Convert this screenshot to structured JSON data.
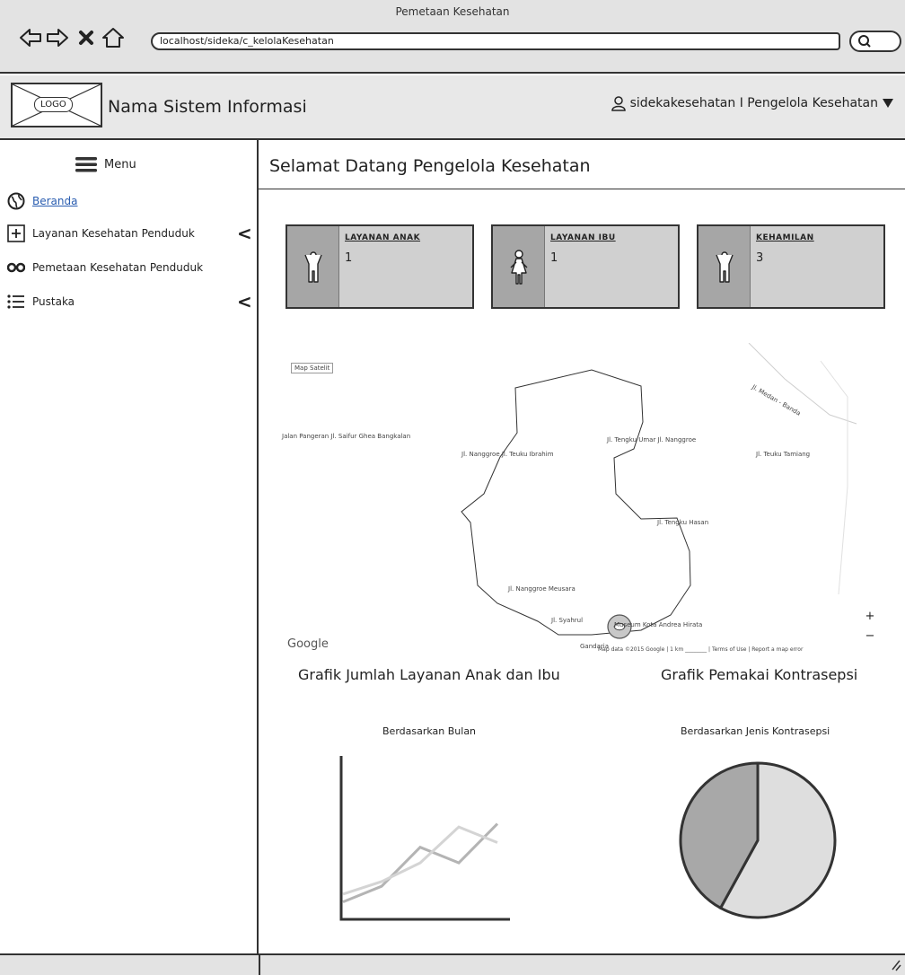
{
  "window": {
    "title": "Pemetaan Kesehatan",
    "url": "localhost/sideka/c_kelolaKesehatan"
  },
  "header": {
    "logo_text": "LOGO",
    "app_name": "Nama Sistem Informasi",
    "user_label": "sidekakesehatan I Pengelola Kesehatan"
  },
  "sidebar": {
    "menu_label": "Menu",
    "items": [
      {
        "label": "Beranda",
        "icon": "globe-icon",
        "active": true
      },
      {
        "label": "Layanan Kesehatan Penduduk",
        "icon": "plus-box-icon",
        "has_submenu": true
      },
      {
        "label": "Pemetaan Kesehatan Penduduk",
        "icon": "glasses-icon",
        "has_submenu": false
      },
      {
        "label": "Pustaka",
        "icon": "list-icon",
        "has_submenu": true
      }
    ]
  },
  "main": {
    "welcome": "Selamat Datang Pengelola Kesehatan",
    "cards": [
      {
        "title": "LAYANAN ANAK",
        "value": "1",
        "icon": "child-icon"
      },
      {
        "title": "LAYANAN IBU",
        "value": "1",
        "icon": "woman-icon"
      },
      {
        "title": "KEHAMILAN",
        "value": "3",
        "icon": "child-icon"
      }
    ],
    "map": {
      "type_label": "Map   Satelit",
      "google": "Google",
      "footer": "Map data ©2015 Google  |  1 km ________  |  Terms of Use  |  Report a map error",
      "place_labels": [
        "Jalan Pangeran Jl. Saifur Ghea Bangkalan",
        "Jl. Nanggroe Jl. Teuku Ibrahim",
        "Jl. Tengku Umar Jl. Nanggroe",
        "Jl. Medan - Banda",
        "Jl. Teuku Tamiang",
        "Jl. Tengku Hasan",
        "Jl. Nanggroe Meusara",
        "Jl. Syahrul",
        "Gandaria",
        "Museum Kota Andrea Hirata"
      ],
      "zoom_in": "+",
      "zoom_out": "−"
    },
    "chart_left": {
      "title": "Grafik Jumlah Layanan Anak dan Ibu",
      "subtitle": "Berdasarkan Bulan"
    },
    "chart_right": {
      "title": "Grafik Pemakai Kontrasepsi",
      "subtitle": "Berdasarkan Jenis Kontrasepsi"
    }
  },
  "chart_data": [
    {
      "type": "line",
      "title": "Grafik Jumlah Layanan Anak dan Ibu",
      "subtitle": "Berdasarkan Bulan",
      "x": [
        1,
        2,
        3,
        4,
        5
      ],
      "series": [
        {
          "values": [
            1,
            2,
            4.5,
            3.5,
            6
          ]
        },
        {
          "values": [
            1.5,
            2.3,
            3.5,
            5.8,
            4.8
          ]
        }
      ],
      "ylim": [
        0,
        10
      ],
      "colors": [
        "#b4b4b4",
        "#d4d4d4"
      ]
    },
    {
      "type": "pie",
      "title": "Grafik Pemakai Kontrasepsi",
      "subtitle": "Berdasarkan Jenis Kontrasepsi",
      "values": [
        58,
        42
      ],
      "colors": [
        "#dedede",
        "#a8a8a8"
      ]
    }
  ]
}
